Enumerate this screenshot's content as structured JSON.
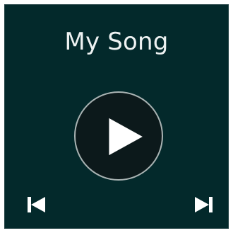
{
  "player": {
    "title": "My Song",
    "play_icon": "play-icon",
    "prev_icon": "skip-previous-icon",
    "next_icon": "skip-next-icon"
  },
  "colors": {
    "background": "#03292b",
    "button_fill": "#0c191b",
    "button_border": "#a9b3b3",
    "foreground": "#ffffff"
  }
}
